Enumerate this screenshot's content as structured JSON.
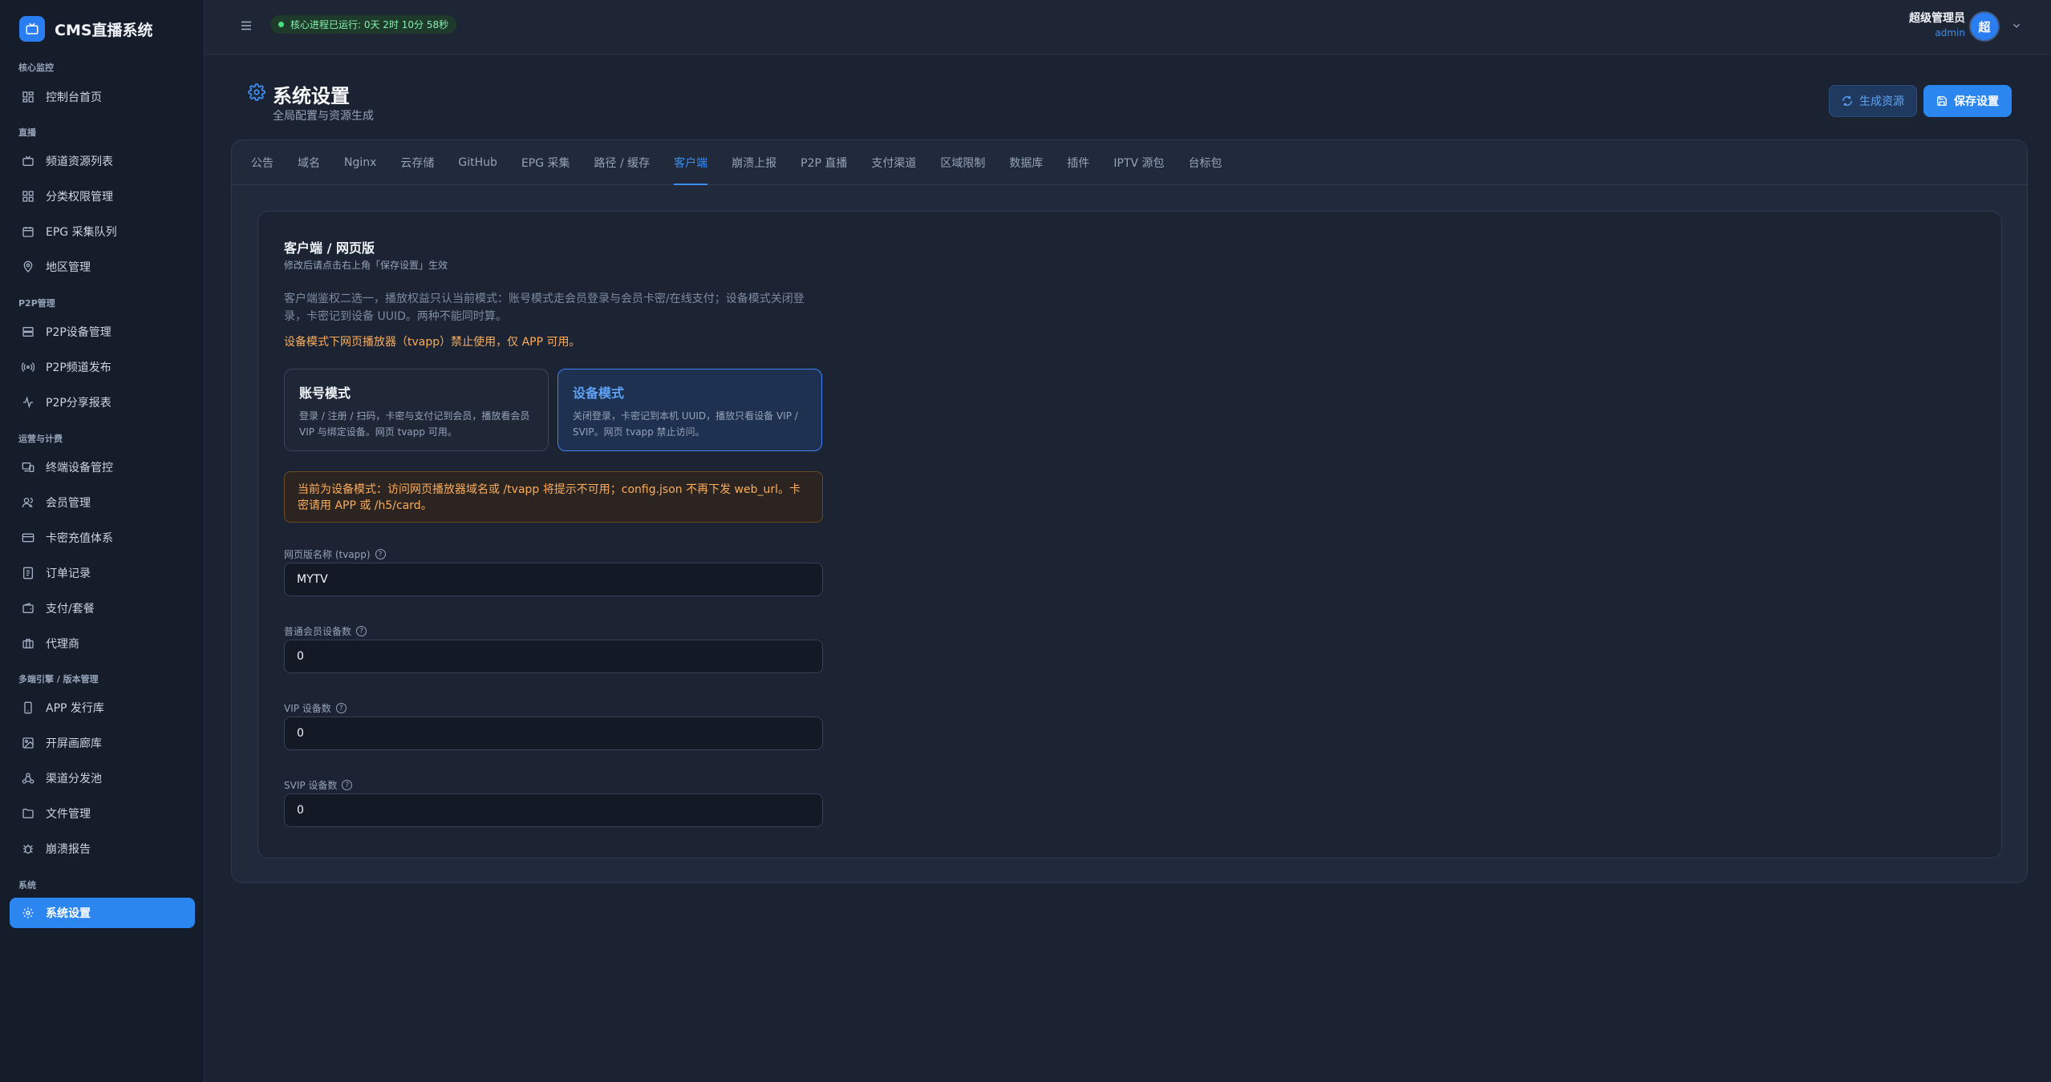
{
  "app": {
    "name": "CMS直播系统"
  },
  "sidebar": {
    "sections": [
      {
        "title": "核心监控",
        "items": [
          {
            "label": "控制台首页",
            "icon": "dashboard-icon"
          }
        ]
      },
      {
        "title": "直播",
        "items": [
          {
            "label": "频道资源列表",
            "icon": "tv-icon"
          },
          {
            "label": "分类权限管理",
            "icon": "grid-icon"
          },
          {
            "label": "EPG 采集队列",
            "icon": "calendar-icon"
          },
          {
            "label": "地区管理",
            "icon": "map-pin-icon"
          }
        ]
      },
      {
        "title": "P2P管理",
        "items": [
          {
            "label": "P2P设备管理",
            "icon": "server-icon"
          },
          {
            "label": "P2P频道发布",
            "icon": "broadcast-icon"
          },
          {
            "label": "P2P分享报表",
            "icon": "activity-icon"
          }
        ]
      },
      {
        "title": "运营与计费",
        "items": [
          {
            "label": "终端设备管控",
            "icon": "devices-icon"
          },
          {
            "label": "会员管理",
            "icon": "users-icon"
          },
          {
            "label": "卡密充值体系",
            "icon": "credit-card-icon"
          },
          {
            "label": "订单记录",
            "icon": "receipt-icon"
          },
          {
            "label": "支付/套餐",
            "icon": "wallet-icon"
          },
          {
            "label": "代理商",
            "icon": "briefcase-icon"
          }
        ]
      },
      {
        "title": "多端引擎 / 版本管理",
        "items": [
          {
            "label": "APP 发行库",
            "icon": "smartphone-icon"
          },
          {
            "label": "开屏画廊库",
            "icon": "image-icon"
          },
          {
            "label": "渠道分发池",
            "icon": "share-icon"
          },
          {
            "label": "文件管理",
            "icon": "folder-icon"
          },
          {
            "label": "崩溃报告",
            "icon": "bug-icon"
          }
        ]
      },
      {
        "title": "系统",
        "items": [
          {
            "label": "系统设置",
            "icon": "settings-icon",
            "active": true
          }
        ]
      }
    ]
  },
  "topbar": {
    "status": "核心进程已运行: 0天 2时 10分 58秒",
    "user_name": "超级管理员",
    "user_role": "admin",
    "avatar_text": "超"
  },
  "page": {
    "title": "系统设置",
    "subtitle": "全局配置与资源生成",
    "generate_label": "生成资源",
    "save_label": "保存设置"
  },
  "tabs": [
    "公告",
    "域名",
    "Nginx",
    "云存储",
    "GitHub",
    "EPG 采集",
    "路径 / 缓存",
    "客户端",
    "崩溃上报",
    "P2P 直播",
    "支付渠道",
    "区域限制",
    "数据库",
    "插件",
    "IPTV 源包",
    "台标包"
  ],
  "active_tab": "客户端",
  "client": {
    "section_title": "客户端 / 网页版",
    "section_sub": "修改后请点击右上角「保存设置」生效",
    "description": "客户端鉴权二选一，播放权益只认当前模式：账号模式走会员登录与会员卡密/在线支付；设备模式关闭登录，卡密记到设备 UUID。两种不能同时算。",
    "warning": "设备模式下网页播放器（tvapp）禁止使用，仅 APP 可用。",
    "modes": {
      "account": {
        "title": "账号模式",
        "desc": "登录 / 注册 / 扫码，卡密与支付记到会员，播放看会员 VIP 与绑定设备。网页 tvapp 可用。"
      },
      "device": {
        "title": "设备模式",
        "desc": "关闭登录，卡密记到本机 UUID，播放只看设备 VIP / SVIP。网页 tvapp 禁止访问。",
        "selected": true
      }
    },
    "notice": "当前为设备模式：访问网页播放器域名或 /tvapp 将提示不可用；config.json 不再下发 web_url。卡密请用 APP 或 /h5/card。",
    "fields": {
      "web_name": {
        "label": "网页版名称 (tvapp)",
        "value": "MYTV"
      },
      "normal_devices": {
        "label": "普通会员设备数",
        "value": "0"
      },
      "vip_devices": {
        "label": "VIP 设备数",
        "value": "0"
      },
      "svip_devices": {
        "label": "SVIP 设备数",
        "value": "0"
      }
    }
  },
  "colors": {
    "accent": "#2b86f0",
    "warning": "#fbad5c",
    "success": "#4ade80"
  }
}
